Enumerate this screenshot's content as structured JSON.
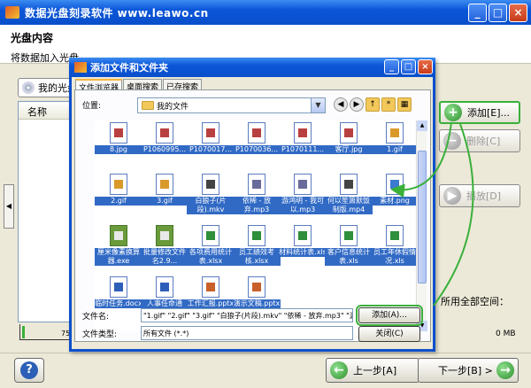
{
  "window": {
    "title": "数据光盘刻录软件 www.leawo.cn"
  },
  "header": {
    "title": "光盘内容",
    "subtitle": "将数据加入光盘。"
  },
  "disc": {
    "label": "我的光盘"
  },
  "list": {
    "col_name": "名称"
  },
  "side_buttons": {
    "add": "添加[E]...",
    "delete": "删除[C]",
    "play": "播放[D]"
  },
  "space": {
    "label": "所用全部空间：",
    "value": "0 MB",
    "tick": "75"
  },
  "footer": {
    "help": "?",
    "prev": "上一步[A]",
    "next": "下一步[B] >"
  },
  "dialog": {
    "title": "添加文件和文件夹",
    "tabs": [
      "文件浏览器",
      "桌面搜索",
      "已存搜索"
    ],
    "location_label": "位置:",
    "location_value": "我的文件",
    "files": [
      {
        "name": "8.jpg",
        "type": "img"
      },
      {
        "name": "P1060995...",
        "type": "img"
      },
      {
        "name": "P1070017...",
        "type": "img"
      },
      {
        "name": "P1070036...",
        "type": "img"
      },
      {
        "name": "P1070111...",
        "type": "img"
      },
      {
        "name": "客厅.jpg",
        "type": "img"
      },
      {
        "name": "1.gif",
        "type": "gif"
      },
      {
        "name": "2.gif",
        "type": "gif"
      },
      {
        "name": "3.gif",
        "type": "gif"
      },
      {
        "name": "白狼子(片段).mkv",
        "type": "mkv"
      },
      {
        "name": "依稀 - 放弃.mp3",
        "type": "mp3"
      },
      {
        "name": "游鸿明 - 我可以.mp3",
        "type": "mp3"
      },
      {
        "name": "何以笙箫默饭制版.mp4",
        "type": "mkv"
      },
      {
        "name": "素材.png",
        "type": "png"
      },
      {
        "name": "厘米像素换算器.exe",
        "type": "exe"
      },
      {
        "name": "批量修改文件名2.9...",
        "type": "exe"
      },
      {
        "name": "各项费用统计表.xlsx",
        "type": "xls"
      },
      {
        "name": "员工绩效考核.xlsx",
        "type": "xls"
      },
      {
        "name": "材料统计表.xls",
        "type": "xls"
      },
      {
        "name": "客户信息统计表.xls",
        "type": "xls"
      },
      {
        "name": "员工年休假情况.xls",
        "type": "xls"
      },
      {
        "name": "临时任务.docx",
        "type": "doc"
      },
      {
        "name": "人事任命通知.docx",
        "type": "doc"
      },
      {
        "name": "工作汇报.pptx",
        "type": "ppt"
      },
      {
        "name": "演示文稿.pptx",
        "type": "ppt"
      }
    ],
    "filename_label": "文件名:",
    "filename_value": "\"1.gif\" \"2.gif\" \"3.gif\" \"白狼子(片段).mkv\" \"依稀 - 放弃.mp3\" \"游鸿明",
    "filetype_label": "文件类型:",
    "filetype_value": "所有文件 (*.*)",
    "add_button": "添加(A)...",
    "close_button": "关闭(C)"
  }
}
